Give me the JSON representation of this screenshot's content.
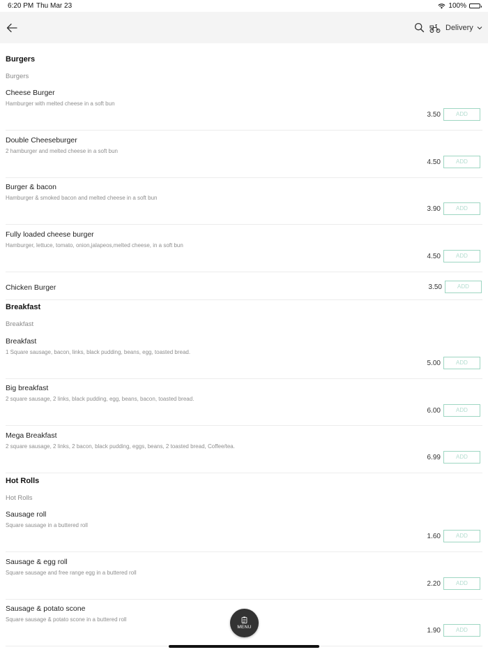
{
  "status_bar": {
    "time": "6:20 PM",
    "date": "Thu Mar 23",
    "battery_text": "100%"
  },
  "header": {
    "delivery_label": "Delivery",
    "icons": [
      "back-arrow-icon",
      "search-icon",
      "scooter-icon",
      "chevron-down-icon"
    ]
  },
  "colors": {
    "add_border": "#9ed6c2",
    "add_text": "#b4ddd0",
    "fab": "#333333",
    "header_bg": "#f4f4f4"
  },
  "sections": [
    {
      "title": "Burgers",
      "subtitle": "Burgers",
      "items": [
        {
          "name": "Cheese Burger",
          "description": "Hamburger with melted cheese in a soft bun",
          "price": "3.50",
          "add_label": "ADD"
        },
        {
          "name": "Double Cheeseburger",
          "description": "2 hamburger and melted cheese in a soft bun",
          "price": "4.50",
          "add_label": "ADD"
        },
        {
          "name": "Burger & bacon",
          "description": "Hamburger & smoked bacon and melted cheese in a soft bun",
          "price": "3.90",
          "add_label": "ADD"
        },
        {
          "name": "Fully loaded cheese burger",
          "description": "Hamburger, lettuce, tomato, onion,jalapeos,melted cheese, in a soft bun",
          "price": "4.50",
          "add_label": "ADD"
        },
        {
          "name": "Chicken Burger",
          "description": "",
          "price": "3.50",
          "add_label": "ADD"
        }
      ]
    },
    {
      "title": "Breakfast",
      "subtitle": "Breakfast",
      "items": [
        {
          "name": "Breakfast",
          "description": "1 Square sausage, bacon, links, black pudding, beans, egg, toasted bread.",
          "price": "5.00",
          "add_label": "ADD"
        },
        {
          "name": "Big breakfast",
          "description": "2 square sausage, 2 links, black pudding, egg, beans, bacon,  toasted bread.",
          "price": "6.00",
          "add_label": "ADD"
        },
        {
          "name": "Mega Breakfast",
          "description": "2 square sausage, 2 links, 2 bacon, black pudding, eggs, beans, 2 toasted bread, Coffee/tea.",
          "price": "6.99",
          "add_label": "ADD"
        }
      ]
    },
    {
      "title": "Hot Rolls",
      "subtitle": "Hot Rolls",
      "items": [
        {
          "name": "Sausage roll",
          "description": "Square sausage in a buttered roll",
          "price": "1.60",
          "add_label": "ADD"
        },
        {
          "name": "Sausage & egg roll",
          "description": "Square sausage and free range egg in a buttered roll",
          "price": "2.20",
          "add_label": "ADD"
        },
        {
          "name": "Sausage & potato scone",
          "description": "Square sausage & potato scone in a buttered roll",
          "price": "1.90",
          "add_label": "ADD"
        }
      ]
    }
  ],
  "menu_button": {
    "label": "MENU"
  }
}
